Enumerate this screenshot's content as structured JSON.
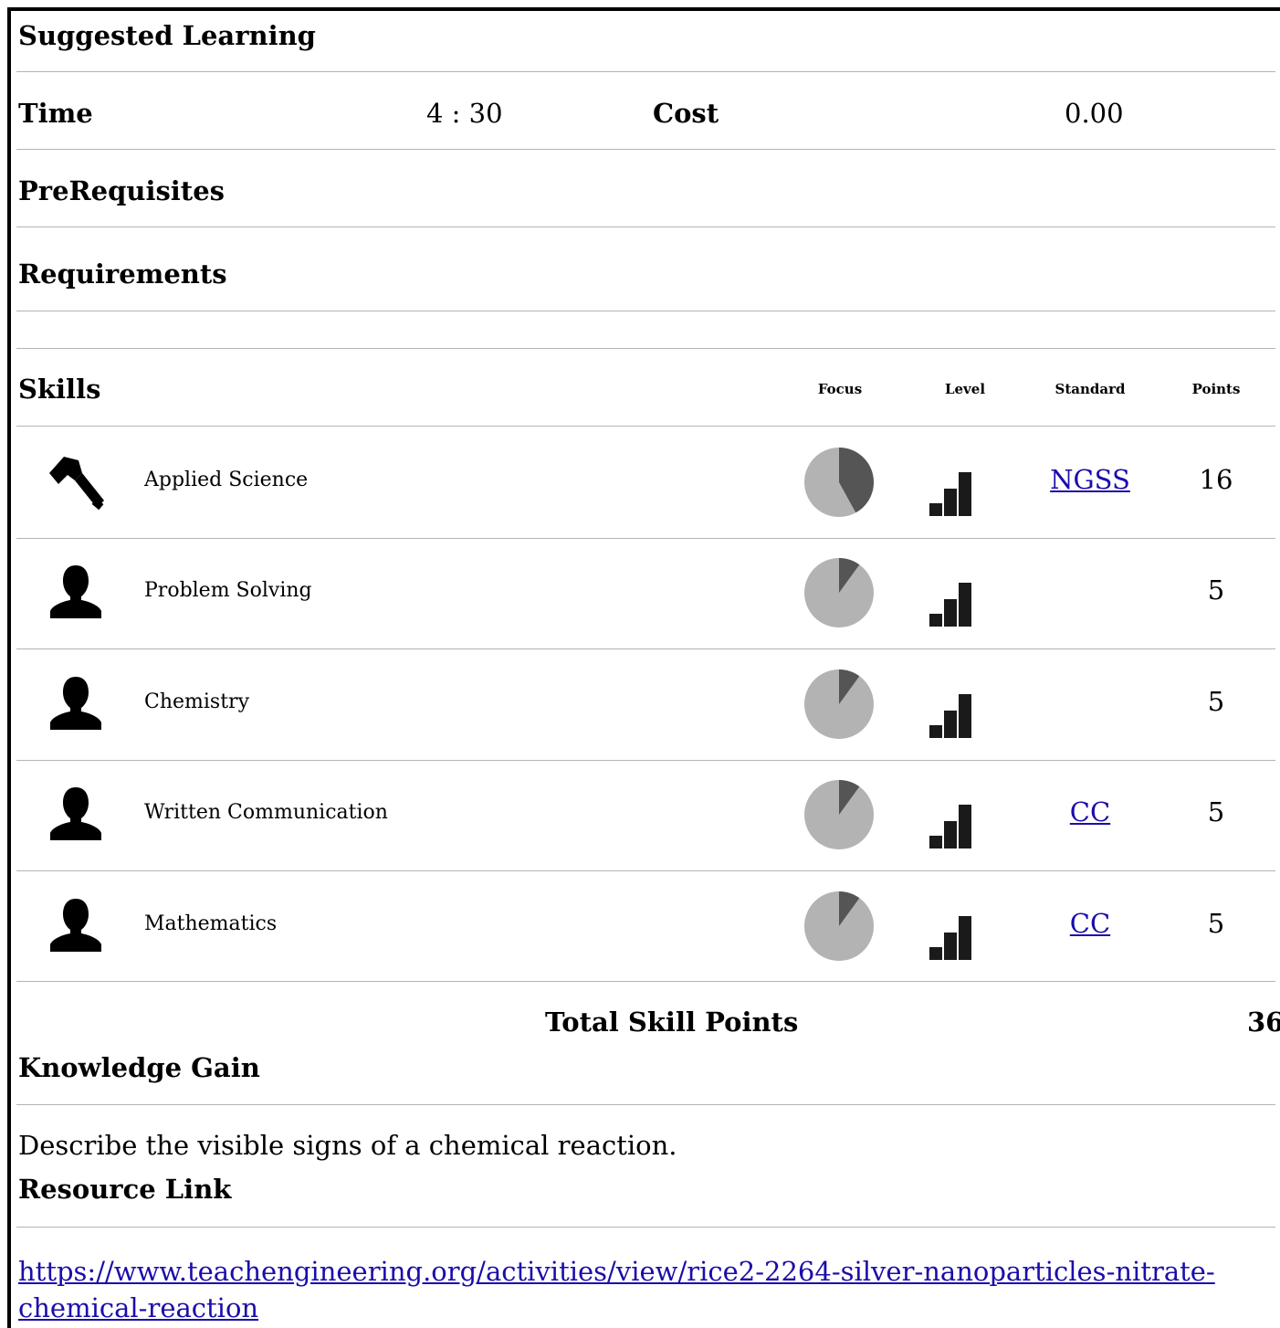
{
  "header": {
    "suggested_learning": "Suggested Learning",
    "time_label": "Time",
    "time_value": "4 : 30",
    "cost_label": "Cost",
    "cost_value": "0.00",
    "prerequisites": "PreRequisites",
    "requirements": "Requirements"
  },
  "skills": {
    "title": "Skills",
    "columns": {
      "focus": "Focus",
      "level": "Level",
      "standard": "Standard",
      "points": "Points"
    },
    "items": [
      {
        "icon": "hammer-icon",
        "label": "Applied Science",
        "focus": 0.42,
        "level": 3,
        "standard": "NGSS",
        "points": "16"
      },
      {
        "icon": "person-icon",
        "label": "Problem Solving",
        "focus": 0.1,
        "level": 3,
        "standard": "",
        "points": "5"
      },
      {
        "icon": "person-icon",
        "label": "Chemistry",
        "focus": 0.1,
        "level": 3,
        "standard": "",
        "points": "5"
      },
      {
        "icon": "person-icon",
        "label": "Written Communication",
        "focus": 0.1,
        "level": 3,
        "standard": "CC",
        "points": "5"
      },
      {
        "icon": "person-icon",
        "label": "Mathematics",
        "focus": 0.1,
        "level": 3,
        "standard": "CC",
        "points": "5"
      }
    ],
    "total_label": "Total Skill Points",
    "total_value": "36"
  },
  "knowledge": {
    "title": "Knowledge Gain",
    "text": "Describe the visible signs of a chemical reaction."
  },
  "resource": {
    "title": "Resource Link",
    "url_line1": "https://www.teachengineering.org/activities/view/rice2-2264-silver-nanoparticles-nitrate-",
    "url_line2": "chemical-reaction"
  },
  "colors": {
    "pie_light": "#b3b3b3",
    "pie_dark": "#555555",
    "link": "#1a0dab"
  }
}
